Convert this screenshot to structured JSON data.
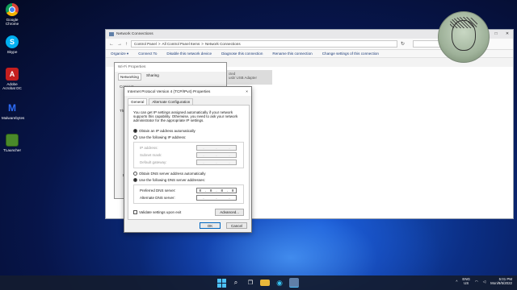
{
  "desktop": {
    "icons": [
      {
        "label": "Google Chrome",
        "glyph": ""
      },
      {
        "label": "Skype",
        "glyph": "S"
      },
      {
        "label": "Adobe Acrobat DC",
        "glyph": "A"
      },
      {
        "label": "Malwarebytes",
        "glyph": "M"
      },
      {
        "label": "TLauncher",
        "glyph": ""
      }
    ]
  },
  "network_window": {
    "title": "Network Connections",
    "breadcrumb": [
      "Control Panel",
      "All Control Panel Items",
      "Network Connections"
    ],
    "commands": [
      "Organize ▾",
      "Connect To",
      "Disable this network device",
      "Diagnose this connection",
      "Rename this connection",
      "Change settings of this connection"
    ],
    "adapter_text": "cted\nusb/ USB Adapter"
  },
  "wifi_window": {
    "title": "Wi-Fi Properties",
    "tabs": [
      "Networking",
      "Sharing"
    ],
    "partial_label_1": "Connect",
    "partial_label_2": "Thi",
    "partial_label_3": "D"
  },
  "ipv4_dialog": {
    "title": "Internet Protocol Version 4 (TCP/IPv4) Properties",
    "close_glyph": "×",
    "tabs": [
      "General",
      "Alternate Configuration"
    ],
    "description": "You can get IP settings assigned automatically if your network supports this capability. Otherwise, you need to ask your network administrator for the appropriate IP settings.",
    "ip_auto_label": "Obtain an IP address automatically",
    "ip_manual_label": "Use the following IP address:",
    "ip_fields": [
      "IP address:",
      "Subnet mask:",
      "Default gateway:"
    ],
    "dns_auto_label": "Obtain DNS server address automatically",
    "dns_manual_label": "Use the following DNS server addresses:",
    "preferred_dns_label": "Preferred DNS server:",
    "preferred_dns_value": [
      "8",
      "8",
      "8",
      "8"
    ],
    "alternate_dns_label": "Alternate DNS server:",
    "alternate_dns_value": [
      "",
      "",
      "",
      ""
    ],
    "validate_label": "Validate settings upon exit",
    "advanced_label": "Advanced...",
    "ok_label": "OK",
    "cancel_label": "Cancel",
    "selected_ip_option": "auto",
    "selected_dns_option": "manual"
  },
  "taskbar": {
    "lang": "ENG",
    "region": "US",
    "time": "5:01 PM",
    "date": "Mon/9/5/2022"
  }
}
